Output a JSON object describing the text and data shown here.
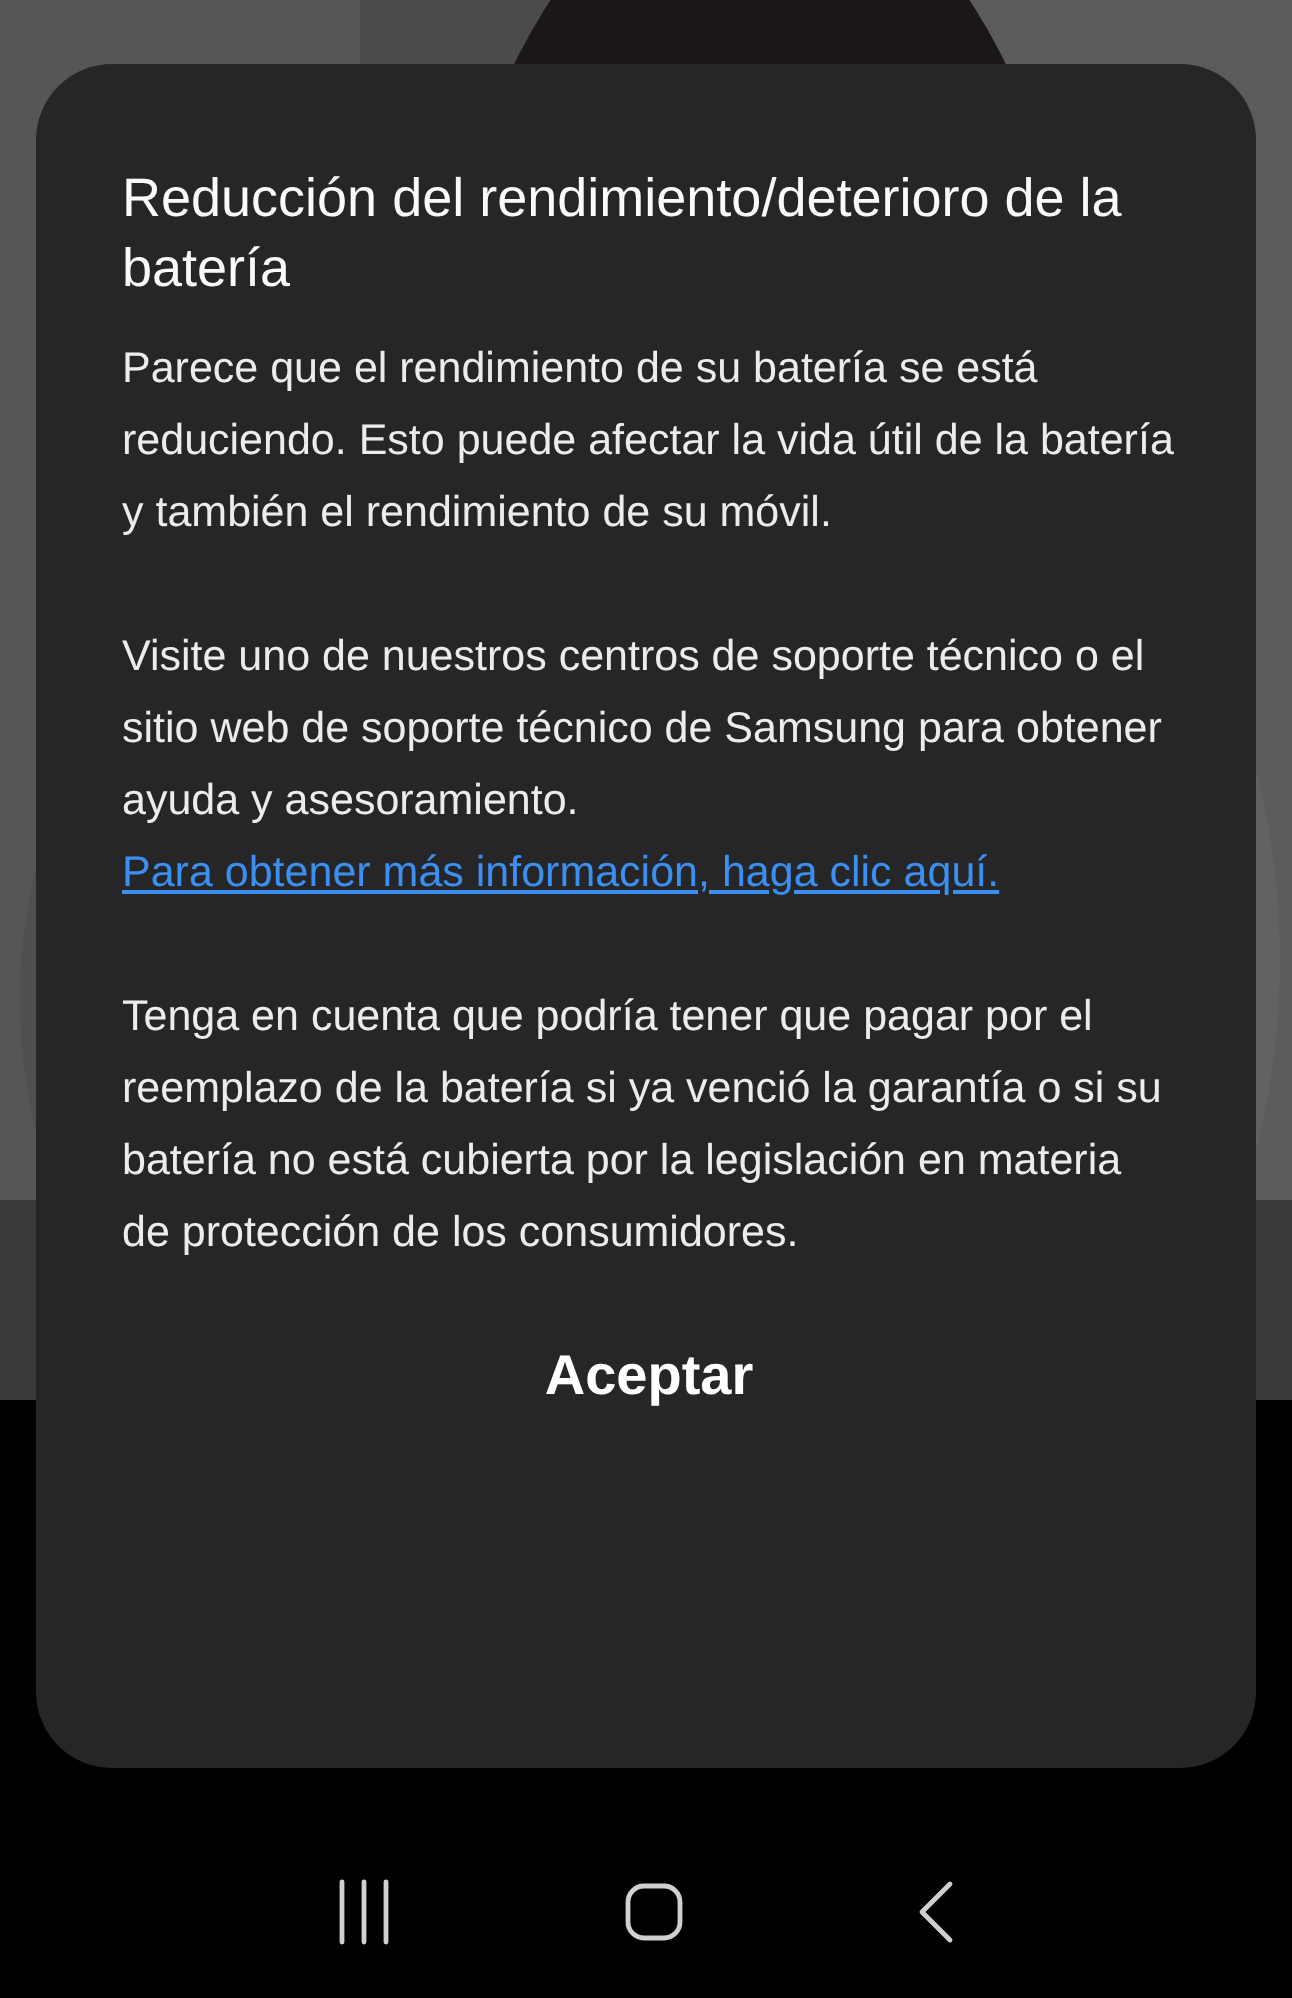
{
  "dialog": {
    "title": "Reducción del rendimiento/deterioro de la batería",
    "paragraphs": [
      {
        "text": "Parece que el rendimiento de su batería se está reduciendo. Esto puede afectar la vida útil de la batería y también el rendimiento de su móvil."
      },
      {
        "text": "Visite uno de nuestros centros de soporte técnico o el sitio web de soporte técnico de Samsung para obtener ayuda y asesoramiento.",
        "link": "Para obtener más información, haga clic aquí."
      },
      {
        "text": "Tenga en cuenta que podría tener que pagar por el reemplazo de la batería si ya venció la garantía o si su batería no está cubierta por la legislación en materia de protección de los consumidores."
      }
    ],
    "button": "Aceptar"
  },
  "nav_bar": [
    {
      "kind": "recents"
    },
    {
      "kind": "home"
    },
    {
      "kind": "back"
    }
  ]
}
